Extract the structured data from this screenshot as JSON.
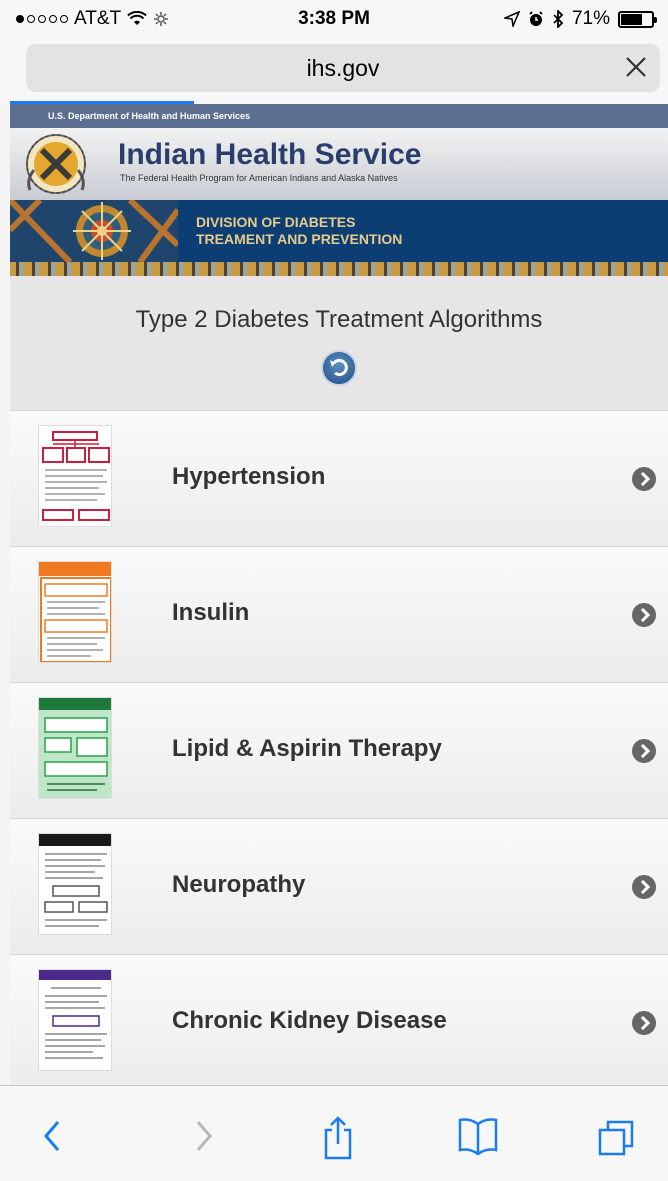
{
  "status_bar": {
    "carrier": "AT&T",
    "time": "3:38 PM",
    "battery_percent": "71%",
    "battery_level": 0.71,
    "icons": [
      "wifi-icon",
      "activity-icon",
      "location-icon",
      "alarm-icon",
      "bluetooth-icon",
      "battery-icon"
    ]
  },
  "browser": {
    "url": "ihs.gov",
    "load_progress": 0.28,
    "clear_icon": "close-icon"
  },
  "banner": {
    "hhs_text": "U.S. Department of Health and Human Services",
    "title": "Indian Health Service",
    "subtitle": "The Federal Health Program for American Indians and Alaska Natives",
    "division_line1": "DIVISION OF DIABETES",
    "division_line2": "TREAMENT AND PREVENTION"
  },
  "page": {
    "title": "Type 2 Diabetes Treatment Algorithms",
    "back_icon": "back-arrow-icon"
  },
  "items": [
    {
      "label": "Hypertension",
      "accent": "#c8213d"
    },
    {
      "label": "Insulin",
      "accent": "#f07a22"
    },
    {
      "label": "Lipid & Aspirin Therapy",
      "accent": "#25a44a"
    },
    {
      "label": "Neuropathy",
      "accent": "#1a1a1a"
    },
    {
      "label": "Chronic Kidney Disease",
      "accent": "#4b2a8a"
    }
  ],
  "toolbar": {
    "icons": [
      "back-icon",
      "forward-icon",
      "share-icon",
      "bookmarks-icon",
      "tabs-icon"
    ],
    "accent": "#1b7cf2"
  }
}
